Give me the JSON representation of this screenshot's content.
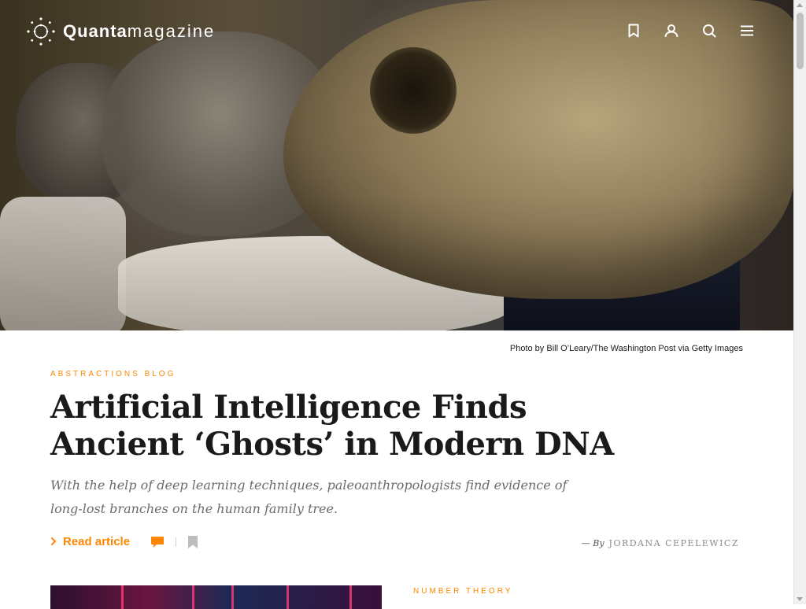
{
  "brand": {
    "name_bold": "Quanta",
    "name_light": "magazine"
  },
  "header": {
    "icons": [
      "bookmark-icon",
      "user-icon",
      "search-icon",
      "menu-icon"
    ]
  },
  "hero": {
    "caption": "Photo by Bill O’Leary/The Washington Post via Getty Images"
  },
  "article": {
    "kicker": "ABSTRACTIONS BLOG",
    "headline": "Artificial Intelligence Finds Ancient ‘Ghosts’ in Modern DNA",
    "dek": "With the help of deep learning techniques, paleoanthropologists find evidence of long-lost branches on the human family tree.",
    "read_label": "Read article",
    "byline_prefix": "— By",
    "author": "JORDANA CEPELEWICZ"
  },
  "next_card": {
    "kicker": "NUMBER THEORY"
  },
  "colors": {
    "accent": "#ff8600",
    "headline": "#1a1a1a",
    "dek": "#6b6b6b"
  }
}
